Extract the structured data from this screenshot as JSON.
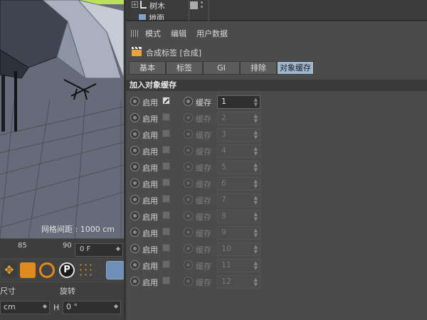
{
  "object_manager": {
    "items": [
      "树木",
      "地面"
    ]
  },
  "viewport": {
    "grid_label": "网格间距 : 1000 cm"
  },
  "timeline": {
    "ticks": [
      "85",
      "90"
    ],
    "frame_value": "0 F"
  },
  "coords": {
    "col1_label": "尺寸",
    "col2_label": "旋转",
    "unit_value": "cm",
    "h_label": "H",
    "h_value": "0 °"
  },
  "attr": {
    "menu": [
      "模式",
      "编辑",
      "用户数据"
    ],
    "tag_title": "合成标签 [合成]",
    "tabs": [
      "基本",
      "标签",
      "GI",
      "排除",
      "对象缓存"
    ],
    "active_tab": "对象缓存",
    "section_title": "加入对象缓存",
    "enable_label": "启用",
    "cache_label": "缓存",
    "rows": [
      {
        "enabled": true,
        "value": "1"
      },
      {
        "enabled": false,
        "value": "2"
      },
      {
        "enabled": false,
        "value": "3"
      },
      {
        "enabled": false,
        "value": "4"
      },
      {
        "enabled": false,
        "value": "5"
      },
      {
        "enabled": false,
        "value": "6"
      },
      {
        "enabled": false,
        "value": "7"
      },
      {
        "enabled": false,
        "value": "8"
      },
      {
        "enabled": false,
        "value": "9"
      },
      {
        "enabled": false,
        "value": "10"
      },
      {
        "enabled": false,
        "value": "11"
      },
      {
        "enabled": false,
        "value": "12"
      }
    ]
  },
  "colors": {
    "active_tab_bg": "#9fb6cf",
    "panel_bg": "#4b4b4b",
    "viewport_bg": "#656b78"
  }
}
